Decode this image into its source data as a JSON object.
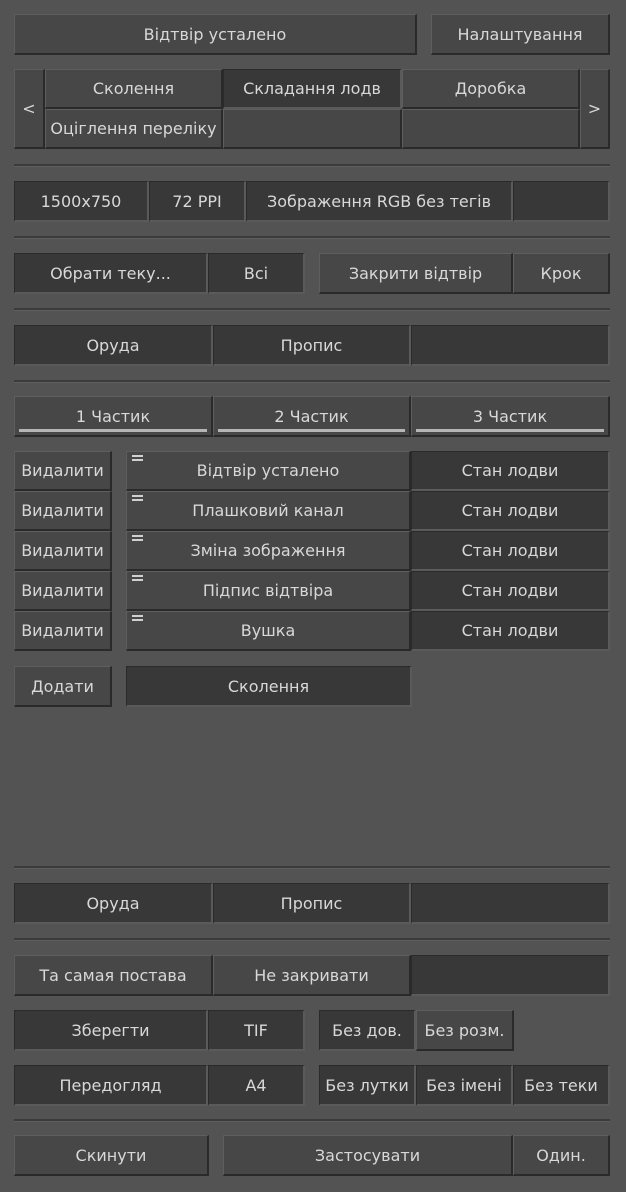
{
  "header": {
    "main_label": "Відтвір усталено",
    "settings_label": "Налаштування"
  },
  "tabs": {
    "prev": "<",
    "next": ">",
    "items": [
      "Сколення",
      "Складання лодв",
      "Доробка",
      "Оціглення переліку"
    ]
  },
  "info": {
    "size": "1500x750",
    "ppi": "72 PPI",
    "mode": "Зображення RGB без тегів"
  },
  "actions": {
    "select_folder": "Обрати теку...",
    "all": "Всі",
    "close": "Закрити відтвір",
    "step": "Крок"
  },
  "panel_tabs": {
    "tools": "Оруда",
    "script": "Пропис"
  },
  "parts": [
    "1 Частик",
    "2 Частик",
    "3 Частик"
  ],
  "steps": {
    "delete_label": "Видалити",
    "items": [
      {
        "name": "Відтвір усталено",
        "state": "Стан лодви"
      },
      {
        "name": "Плашковий канал",
        "state": "Стан лодви"
      },
      {
        "name": "Зміна зображення",
        "state": "Стан лодви"
      },
      {
        "name": "Підпис відтвіра",
        "state": "Стан лодви"
      },
      {
        "name": "Вушка",
        "state": "Стан лодви"
      }
    ],
    "add_label": "Додати",
    "add_value": "Сколення"
  },
  "output": {
    "same_set": "Та самая постава",
    "no_close": "Не закривати",
    "save": "Зберегти",
    "format": "TIF",
    "no_dov": "Без дов.",
    "no_size": "Без розм.",
    "preview": "Передогляд",
    "paper": "А4",
    "no_lutka": "Без лутки",
    "no_name": "Без імені",
    "no_folder": "Без теки"
  },
  "footer": {
    "reset": "Скинути",
    "apply": "Застосувати",
    "one": "Один."
  }
}
